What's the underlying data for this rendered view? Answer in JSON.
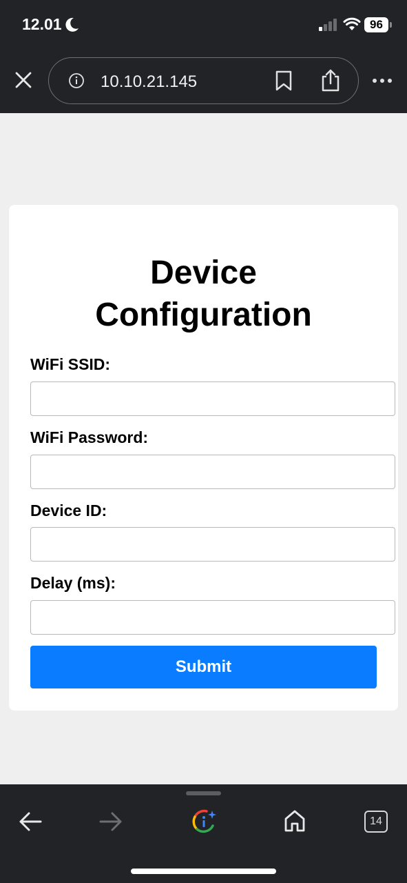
{
  "status_bar": {
    "time": "12.01",
    "battery": "96"
  },
  "browser": {
    "url": "10.10.21.145",
    "tab_count": "14"
  },
  "form": {
    "title_line1": "Device",
    "title_line2": "Configuration",
    "ssid_label": "WiFi SSID:",
    "password_label": "WiFi Password:",
    "device_id_label": "Device ID:",
    "delay_label": "Delay (ms):",
    "submit_label": "Submit"
  },
  "colors": {
    "accent": "#0a7cff",
    "chrome": "#222327",
    "page": "#efefef"
  },
  "icons": [
    "moon-icon",
    "signal-icon",
    "wifi-icon",
    "close-icon",
    "info-icon",
    "bookmark-icon",
    "share-icon",
    "more-icon",
    "back-icon",
    "forward-icon",
    "google-lens-icon",
    "home-icon",
    "tabs-icon"
  ]
}
